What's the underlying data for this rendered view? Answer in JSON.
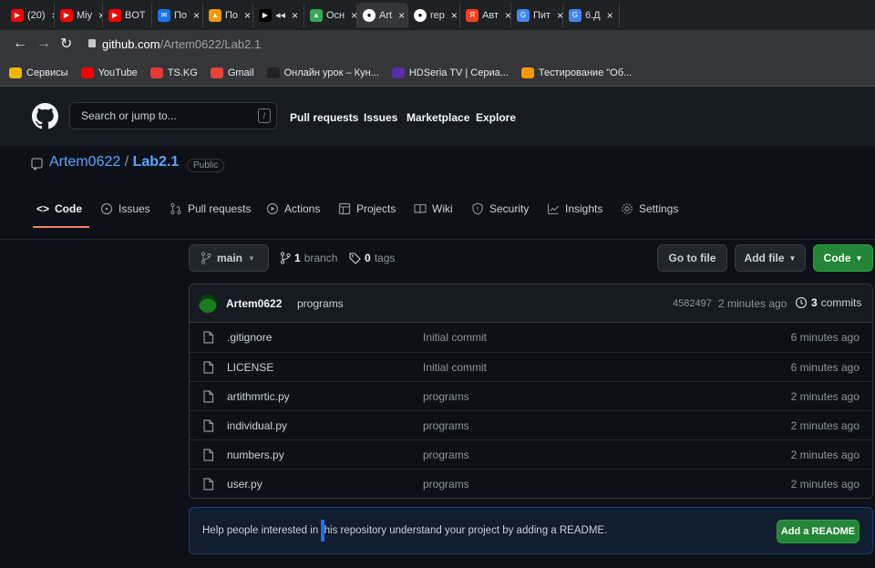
{
  "browser": {
    "tabs": [
      {
        "label": "(20)",
        "fav_color": "#ff0000",
        "fav": "▶"
      },
      {
        "label": "Miy",
        "fav_color": "#ff0000",
        "fav": "▶"
      },
      {
        "label": "BOT",
        "fav_color": "#ff0000",
        "fav": "▶"
      },
      {
        "label": "По",
        "fav_color": "#1a73e8",
        "fav": "✉"
      },
      {
        "label": "По",
        "fav_color": "#f29900",
        "fav": "▲"
      },
      {
        "label": "◂◂",
        "fav_color": "#000000",
        "fav": "▶"
      },
      {
        "label": "Осн",
        "fav_color": "#34a853",
        "fav": "▲"
      },
      {
        "label": "Art",
        "fav_color": "#ffffff",
        "fav": "●",
        "active": true
      },
      {
        "label": "rep",
        "fav_color": "#ffffff",
        "fav": "●"
      },
      {
        "label": "Авт",
        "fav_color": "#fc3f1d",
        "fav": "Я"
      },
      {
        "label": "Пит",
        "fav_color": "#4285f4",
        "fav": "G"
      },
      {
        "label": "6.Д",
        "fav_color": "#4285f4",
        "fav": "G"
      }
    ],
    "url_host": "github.com",
    "url_path": "/Artem0622/Lab2.1",
    "bookmarks": [
      {
        "label": "Сервисы",
        "color": "#f4b400",
        "icon": "grid-icon"
      },
      {
        "label": "YouTube",
        "color": "#ff0000",
        "icon": "youtube-icon"
      },
      {
        "label": "TS.KG",
        "color": "#e53935",
        "icon": "play-icon"
      },
      {
        "label": "Gmail",
        "color": "#ea4335",
        "icon": "gmail-icon"
      },
      {
        "label": "Онлайн урок – Кун...",
        "color": "#222222",
        "icon": "k-icon"
      },
      {
        "label": "HDSeria TV | Сериа...",
        "color": "#5a2ea6",
        "icon": "hd-icon"
      },
      {
        "label": "Тестирование \"Об...",
        "color": "#ff9800",
        "icon": "in-icon"
      }
    ]
  },
  "github": {
    "search_placeholder": "Search or jump to...",
    "search_key": "/",
    "nav": [
      "Pull requests",
      "Issues",
      "Marketplace",
      "Explore"
    ],
    "owner": "Artem0622",
    "sep": " / ",
    "repo": "Lab2.1",
    "visibility": "Public",
    "tabs": [
      "Code",
      "Issues",
      "Pull requests",
      "Actions",
      "Projects",
      "Wiki",
      "Security",
      "Insights",
      "Settings"
    ],
    "branch": "main",
    "branch_count": "1",
    "branch_word": "branch",
    "tag_count": "0",
    "tag_word": "tags",
    "go_to_file": "Go to file",
    "add_file": "Add file",
    "code_btn": "Code",
    "commit_author": "Artem0622",
    "commit_message": "programs",
    "commit_hash": "4582497",
    "commit_time": "2 minutes ago",
    "commit_count": "3",
    "commit_word": "commits",
    "files": [
      {
        "name": ".gitignore",
        "message": "Initial commit",
        "time": "6 minutes ago"
      },
      {
        "name": "LICENSE",
        "message": "Initial commit",
        "time": "6 minutes ago"
      },
      {
        "name": "artithmrtic.py",
        "message": "programs",
        "time": "2 minutes ago"
      },
      {
        "name": "individual.py",
        "message": "programs",
        "time": "2 minutes ago"
      },
      {
        "name": "numbers.py",
        "message": "programs",
        "time": "2 minutes ago"
      },
      {
        "name": "user.py",
        "message": "programs",
        "time": "2 minutes ago"
      }
    ],
    "readme_text": "Help people interested in this repository understand your project by adding a README.",
    "readme_button": "Add a README"
  }
}
